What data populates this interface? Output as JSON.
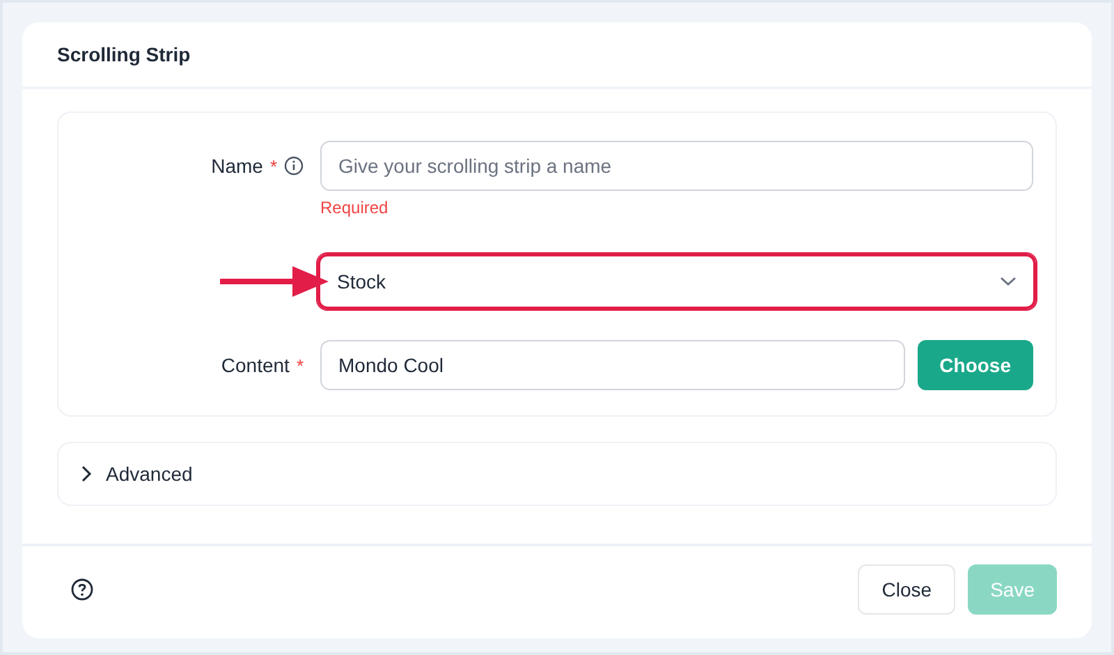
{
  "dialog": {
    "title": "Scrolling Strip"
  },
  "fields": [
    {
      "kind": "text",
      "label": "Name",
      "required_mark": "*",
      "info": true,
      "placeholder": "Give your scrolling strip a name",
      "error": "Required",
      "highlighted": false
    },
    {
      "kind": "select",
      "value": "Stock",
      "highlighted": true
    },
    {
      "kind": "picker",
      "label": "Content",
      "required_mark": "*",
      "value": "Mondo Cool",
      "button": "Choose",
      "highlighted": false
    }
  ],
  "advanced": {
    "label": "Advanced",
    "expanded": false
  },
  "footer": {
    "buttons": [
      {
        "label": "Close",
        "kind": "secondary",
        "disabled": false
      },
      {
        "label": "Save",
        "kind": "primary",
        "disabled": true
      }
    ]
  }
}
